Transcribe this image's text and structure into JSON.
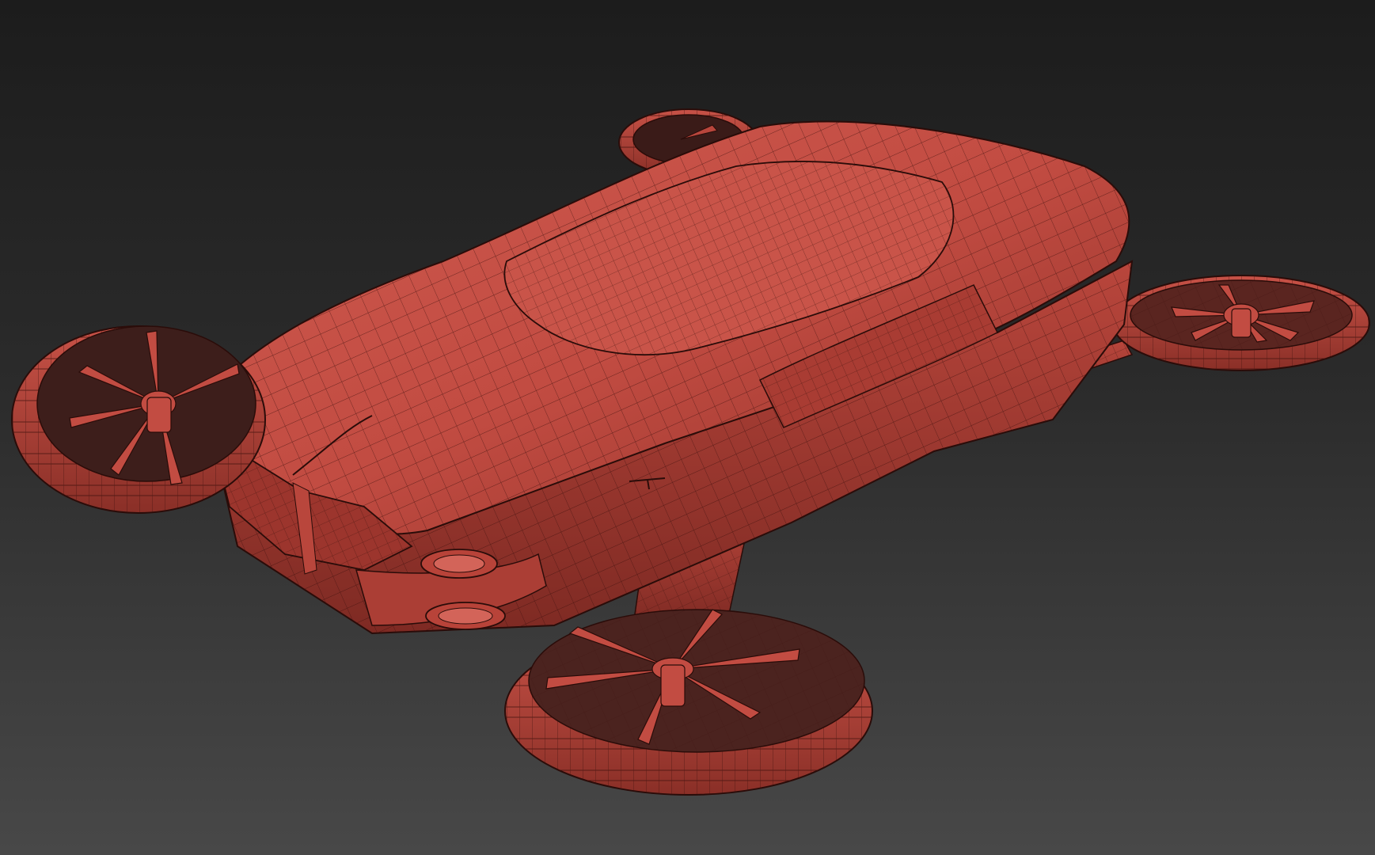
{
  "viewport": {
    "kind": "3d-perspective-view",
    "shading": "wireframe-on-shaded",
    "background_top": "#1c1c1c",
    "background_bottom": "#484848"
  },
  "model": {
    "subject": "flying-car",
    "body_color": "#c24c42",
    "body_shadow": "#8f3028",
    "body_highlight": "#d8685c",
    "wire_color": "#2a0c09",
    "rotor_count": 4
  },
  "icons": [
    "rotor-icon",
    "headlight-icon",
    "emblem-icon"
  ]
}
